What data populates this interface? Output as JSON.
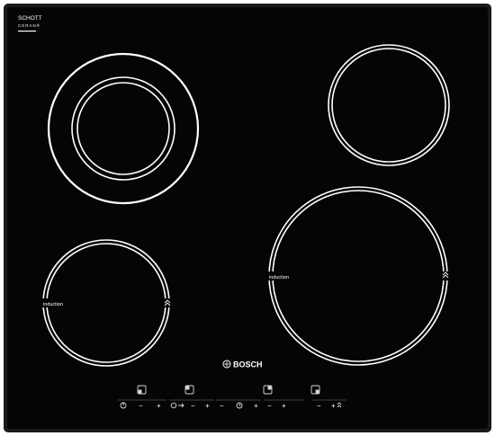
{
  "appliance": {
    "brand": "BOSCH",
    "glass_maker_line1": "SCHOTT",
    "glass_maker_line2": "CERAN®",
    "zone_label": "induction",
    "colors": {
      "glass": "#050505",
      "frame": "#1a1a1a",
      "ring": "#ffffff",
      "controls": "#d8d8d8"
    }
  },
  "cooking_zones": [
    {
      "name": "front-left",
      "label": "induction",
      "icons": [
        "power-boost-icon"
      ]
    },
    {
      "name": "front-right",
      "label": "induction",
      "icons": [
        "power-boost-icon"
      ]
    },
    {
      "name": "rear-left",
      "type": "dual-ring"
    },
    {
      "name": "rear-right",
      "type": "single-ring"
    }
  ],
  "controls": {
    "zone_selectors": [
      "zone-front-left-icon",
      "zone-rear-left-icon",
      "zone-rear-right-icon",
      "zone-front-right-icon"
    ],
    "minus_symbol": "−",
    "plus_symbol": "+",
    "icons": [
      "power-icon",
      "lock-icon",
      "timer-icon",
      "boost-icon"
    ]
  }
}
